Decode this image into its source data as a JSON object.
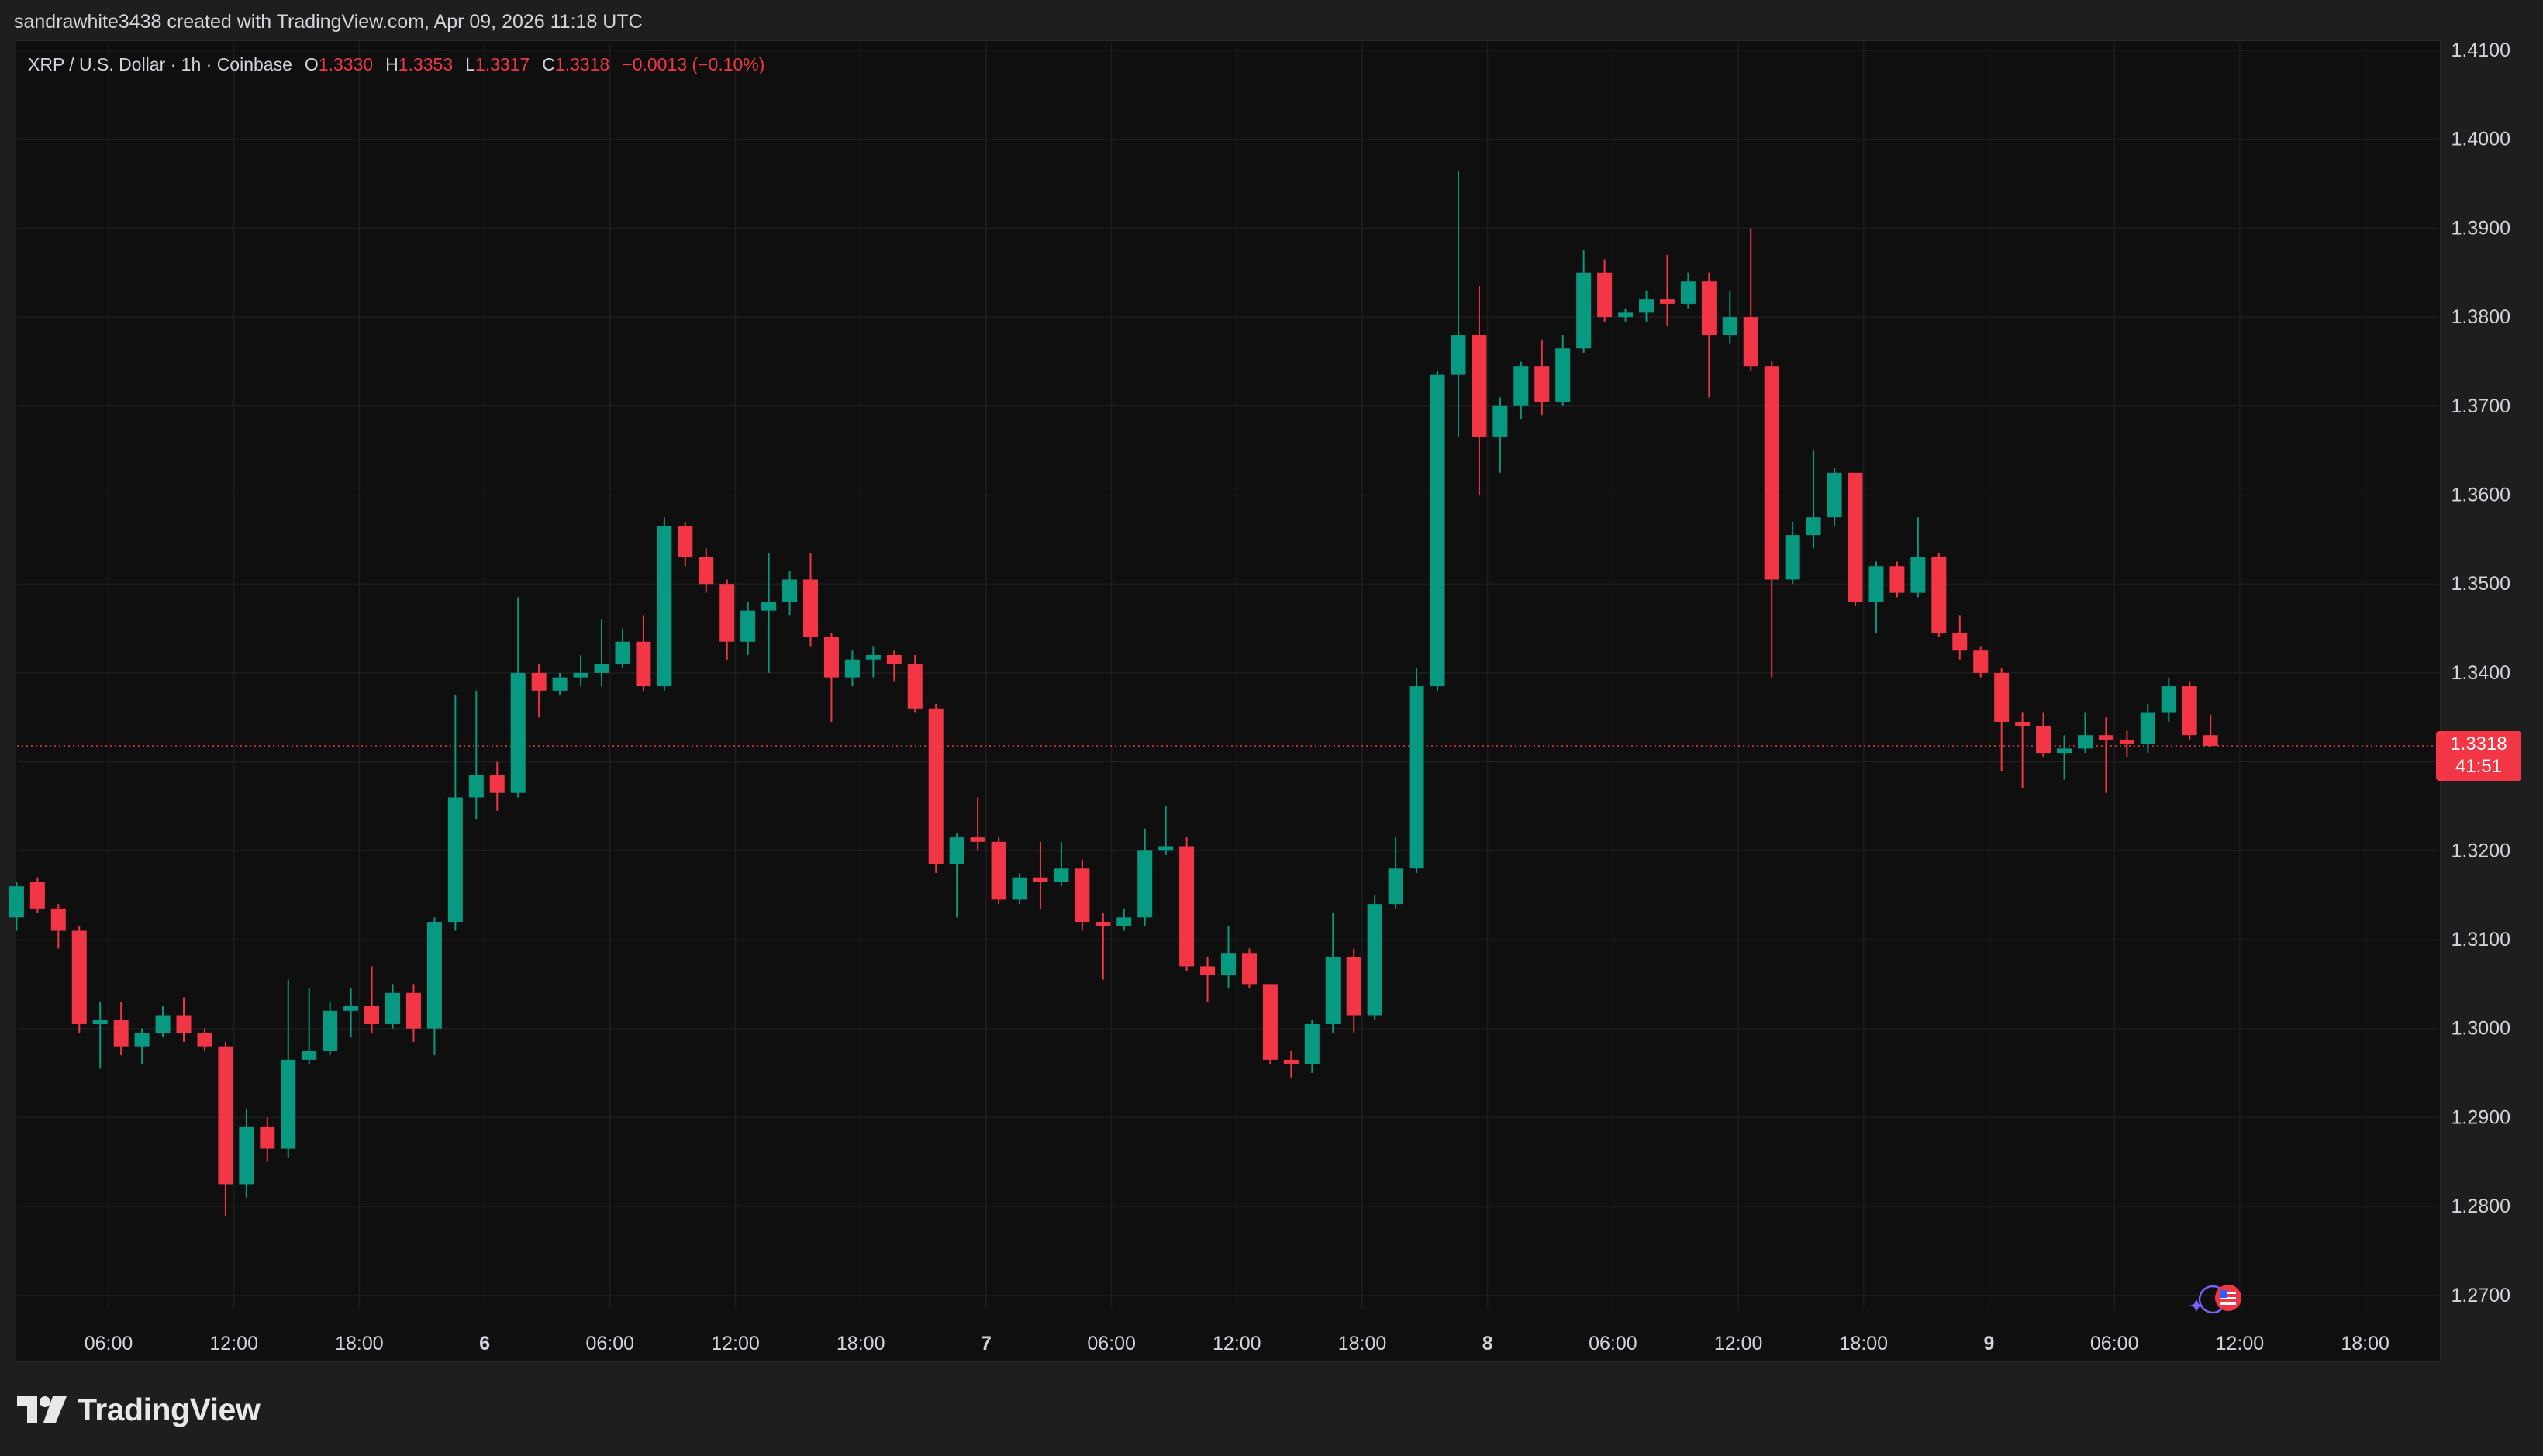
{
  "caption": "sandrawhite3438 created with TradingView.com, Apr 09, 2026 11:18 UTC",
  "legend": {
    "symbol": "XRP / U.S. Dollar · 1h · Coinbase",
    "o_label": "O",
    "o": "1.3330",
    "h_label": "H",
    "h": "1.3353",
    "l_label": "L",
    "l": "1.3317",
    "c_label": "C",
    "c": "1.3318",
    "change": "−0.0013 (−0.10%)"
  },
  "price_tag": {
    "price": "1.3318",
    "countdown": "41:51"
  },
  "brand": "TradingView",
  "colors": {
    "up": "#089981",
    "down": "#f23645",
    "background": "#0f0f0f",
    "grid": "#1e1e1e",
    "text": "#d1d4dc"
  },
  "chart_data": {
    "type": "candlestick",
    "title": "XRP / U.S. Dollar · 1h · Coinbase",
    "interval": "1h",
    "y_axis": {
      "side": "right",
      "range": [
        1.265,
        1.41
      ],
      "ticks": [
        "1.2700",
        "1.2800",
        "1.2900",
        "1.3000",
        "1.3100",
        "1.3200",
        "1.3300",
        "1.3400",
        "1.3500",
        "1.3600",
        "1.3700",
        "1.3800",
        "1.3900",
        "1.4000",
        "1.4100"
      ]
    },
    "x_axis": {
      "ticks": [
        {
          "label": "06:00",
          "hour": 6
        },
        {
          "label": "12:00",
          "hour": 12
        },
        {
          "label": "18:00",
          "hour": 18
        },
        {
          "label": "6",
          "hour": 24,
          "bold": true
        },
        {
          "label": "06:00",
          "hour": 30
        },
        {
          "label": "12:00",
          "hour": 36
        },
        {
          "label": "18:00",
          "hour": 42
        },
        {
          "label": "7",
          "hour": 48,
          "bold": true
        },
        {
          "label": "06:00",
          "hour": 54
        },
        {
          "label": "12:00",
          "hour": 60
        },
        {
          "label": "18:00",
          "hour": 66
        },
        {
          "label": "8",
          "hour": 72,
          "bold": true
        },
        {
          "label": "06:00",
          "hour": 78
        },
        {
          "label": "12:00",
          "hour": 84
        },
        {
          "label": "18:00",
          "hour": 90
        },
        {
          "label": "9",
          "hour": 96,
          "bold": true
        },
        {
          "label": "06:00",
          "hour": 102
        },
        {
          "label": "12:00",
          "hour": 108
        },
        {
          "label": "18:00",
          "hour": 114
        }
      ]
    },
    "first_candle_hour": 1.6,
    "grid": true,
    "last_price_line": 1.3318,
    "candles": [
      [
        1.3125,
        1.316,
        1.311,
        1.3165
      ],
      [
        1.3165,
        1.3135,
        1.313,
        1.317
      ],
      [
        1.3135,
        1.311,
        1.309,
        1.314
      ],
      [
        1.311,
        1.3005,
        1.2995,
        1.3115
      ],
      [
        1.3005,
        1.301,
        1.2955,
        1.303
      ],
      [
        1.301,
        1.298,
        1.297,
        1.303
      ],
      [
        1.298,
        1.2995,
        1.296,
        1.3
      ],
      [
        1.2995,
        1.3015,
        1.299,
        1.3025
      ],
      [
        1.3015,
        1.2995,
        1.2985,
        1.3035
      ],
      [
        1.2995,
        1.298,
        1.2975,
        1.3
      ],
      [
        1.298,
        1.2825,
        1.279,
        1.2985
      ],
      [
        1.2825,
        1.289,
        1.281,
        1.291
      ],
      [
        1.289,
        1.2865,
        1.285,
        1.29
      ],
      [
        1.2865,
        1.2965,
        1.2855,
        1.3055
      ],
      [
        1.2965,
        1.2975,
        1.296,
        1.3045
      ],
      [
        1.2975,
        1.302,
        1.297,
        1.303
      ],
      [
        1.302,
        1.3025,
        1.299,
        1.3045
      ],
      [
        1.3025,
        1.3005,
        1.2995,
        1.307
      ],
      [
        1.3005,
        1.304,
        1.3,
        1.305
      ],
      [
        1.304,
        1.3,
        1.2985,
        1.305
      ],
      [
        1.3,
        1.312,
        1.297,
        1.3125
      ],
      [
        1.312,
        1.326,
        1.311,
        1.3375
      ],
      [
        1.326,
        1.3285,
        1.3235,
        1.338
      ],
      [
        1.3285,
        1.3265,
        1.3245,
        1.33
      ],
      [
        1.3265,
        1.34,
        1.326,
        1.3485
      ],
      [
        1.34,
        1.338,
        1.335,
        1.341
      ],
      [
        1.338,
        1.3395,
        1.3375,
        1.34
      ],
      [
        1.3395,
        1.34,
        1.3385,
        1.342
      ],
      [
        1.34,
        1.341,
        1.3385,
        1.346
      ],
      [
        1.341,
        1.3435,
        1.3405,
        1.345
      ],
      [
        1.3435,
        1.3385,
        1.338,
        1.3465
      ],
      [
        1.3385,
        1.3565,
        1.338,
        1.3575
      ],
      [
        1.3565,
        1.353,
        1.352,
        1.357
      ],
      [
        1.353,
        1.35,
        1.349,
        1.354
      ],
      [
        1.35,
        1.3435,
        1.3415,
        1.3505
      ],
      [
        1.3435,
        1.347,
        1.342,
        1.348
      ],
      [
        1.347,
        1.348,
        1.34,
        1.3535
      ],
      [
        1.348,
        1.3505,
        1.3465,
        1.3515
      ],
      [
        1.3505,
        1.344,
        1.343,
        1.3535
      ],
      [
        1.344,
        1.3395,
        1.3345,
        1.3445
      ],
      [
        1.3395,
        1.3415,
        1.3385,
        1.3425
      ],
      [
        1.3415,
        1.342,
        1.3395,
        1.343
      ],
      [
        1.342,
        1.341,
        1.339,
        1.3425
      ],
      [
        1.341,
        1.336,
        1.3355,
        1.342
      ],
      [
        1.336,
        1.3185,
        1.3175,
        1.3365
      ],
      [
        1.3185,
        1.3215,
        1.3125,
        1.322
      ],
      [
        1.3215,
        1.321,
        1.32,
        1.326
      ],
      [
        1.321,
        1.3145,
        1.314,
        1.3215
      ],
      [
        1.3145,
        1.317,
        1.314,
        1.3175
      ],
      [
        1.317,
        1.3165,
        1.3135,
        1.321
      ],
      [
        1.3165,
        1.318,
        1.316,
        1.321
      ],
      [
        1.318,
        1.312,
        1.311,
        1.319
      ],
      [
        1.312,
        1.3115,
        1.3055,
        1.313
      ],
      [
        1.3115,
        1.3125,
        1.311,
        1.3135
      ],
      [
        1.3125,
        1.32,
        1.3115,
        1.3225
      ],
      [
        1.32,
        1.3205,
        1.3195,
        1.325
      ],
      [
        1.3205,
        1.307,
        1.3065,
        1.3215
      ],
      [
        1.307,
        1.306,
        1.303,
        1.308
      ],
      [
        1.306,
        1.3085,
        1.3045,
        1.3115
      ],
      [
        1.3085,
        1.305,
        1.3045,
        1.309
      ],
      [
        1.305,
        1.2965,
        1.296,
        1.305
      ],
      [
        1.2965,
        1.296,
        1.2945,
        1.2975
      ],
      [
        1.296,
        1.3005,
        1.295,
        1.301
      ],
      [
        1.3005,
        1.308,
        1.2995,
        1.313
      ],
      [
        1.308,
        1.3015,
        1.2995,
        1.309
      ],
      [
        1.3015,
        1.314,
        1.301,
        1.315
      ],
      [
        1.314,
        1.318,
        1.3135,
        1.3215
      ],
      [
        1.318,
        1.3385,
        1.3175,
        1.3405
      ],
      [
        1.3385,
        1.3735,
        1.338,
        1.374
      ],
      [
        1.3735,
        1.378,
        1.3665,
        1.3965
      ],
      [
        1.378,
        1.3665,
        1.36,
        1.3835
      ],
      [
        1.3665,
        1.37,
        1.3625,
        1.371
      ],
      [
        1.37,
        1.3745,
        1.3685,
        1.375
      ],
      [
        1.3745,
        1.3705,
        1.369,
        1.3775
      ],
      [
        1.3705,
        1.3765,
        1.37,
        1.378
      ],
      [
        1.3765,
        1.385,
        1.376,
        1.3875
      ],
      [
        1.385,
        1.38,
        1.3795,
        1.3865
      ],
      [
        1.38,
        1.3805,
        1.3795,
        1.381
      ],
      [
        1.3805,
        1.382,
        1.3795,
        1.383
      ],
      [
        1.382,
        1.3815,
        1.379,
        1.387
      ],
      [
        1.3815,
        1.384,
        1.381,
        1.385
      ],
      [
        1.384,
        1.378,
        1.371,
        1.385
      ],
      [
        1.378,
        1.38,
        1.377,
        1.383
      ],
      [
        1.38,
        1.3745,
        1.374,
        1.39
      ],
      [
        1.3745,
        1.3505,
        1.3395,
        1.375
      ],
      [
        1.3505,
        1.3555,
        1.35,
        1.357
      ],
      [
        1.3555,
        1.3575,
        1.354,
        1.365
      ],
      [
        1.3575,
        1.3625,
        1.3565,
        1.363
      ],
      [
        1.3625,
        1.348,
        1.3475,
        1.3625
      ],
      [
        1.348,
        1.352,
        1.3445,
        1.3525
      ],
      [
        1.352,
        1.349,
        1.3485,
        1.3525
      ],
      [
        1.349,
        1.353,
        1.3485,
        1.3575
      ],
      [
        1.353,
        1.3445,
        1.344,
        1.3535
      ],
      [
        1.3445,
        1.3425,
        1.3415,
        1.3465
      ],
      [
        1.3425,
        1.34,
        1.3395,
        1.343
      ],
      [
        1.34,
        1.3345,
        1.329,
        1.3405
      ],
      [
        1.3345,
        1.334,
        1.327,
        1.3355
      ],
      [
        1.334,
        1.331,
        1.3305,
        1.3355
      ],
      [
        1.331,
        1.3315,
        1.328,
        1.333
      ],
      [
        1.3315,
        1.333,
        1.331,
        1.3355
      ],
      [
        1.333,
        1.3325,
        1.3265,
        1.335
      ],
      [
        1.3325,
        1.332,
        1.3305,
        1.3335
      ],
      [
        1.332,
        1.3355,
        1.331,
        1.3365
      ],
      [
        1.3355,
        1.3385,
        1.3345,
        1.3395
      ],
      [
        1.3385,
        1.333,
        1.3325,
        1.339
      ],
      [
        1.333,
        1.3318,
        1.3317,
        1.3353
      ]
    ]
  }
}
